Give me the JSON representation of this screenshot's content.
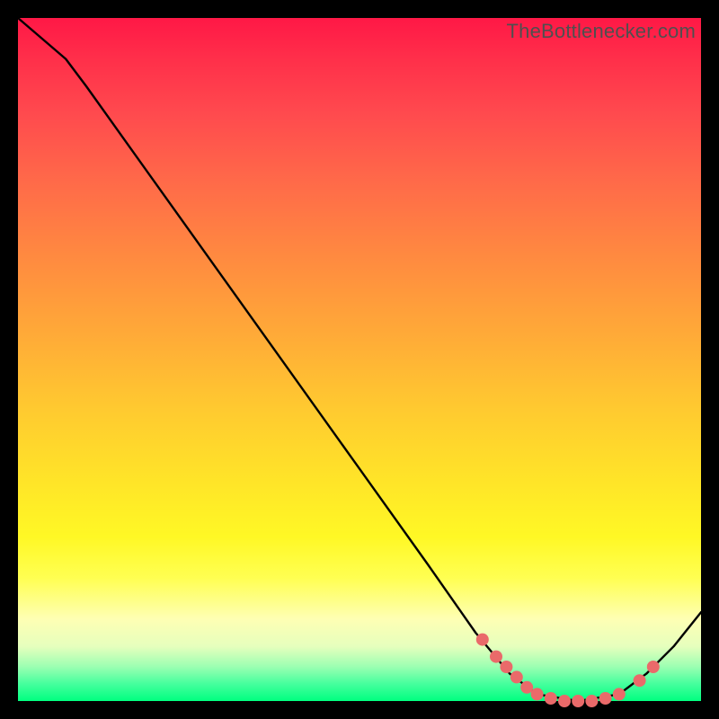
{
  "watermark": "TheBottlenecker.com",
  "colors": {
    "marker": "#ea6a6a",
    "curve": "#000000",
    "frame_bg": "#000000"
  },
  "chart_data": {
    "type": "line",
    "title": "",
    "xlabel": "",
    "ylabel": "",
    "xlim": [
      0,
      100
    ],
    "ylim": [
      0,
      100
    ],
    "curve_points": [
      {
        "x": 0,
        "y_pct": 0
      },
      {
        "x": 7,
        "y_pct": 6
      },
      {
        "x": 10,
        "y_pct": 10
      },
      {
        "x": 20,
        "y_pct": 24
      },
      {
        "x": 30,
        "y_pct": 38
      },
      {
        "x": 40,
        "y_pct": 52
      },
      {
        "x": 50,
        "y_pct": 66
      },
      {
        "x": 60,
        "y_pct": 80
      },
      {
        "x": 67,
        "y_pct": 90
      },
      {
        "x": 72,
        "y_pct": 96
      },
      {
        "x": 76,
        "y_pct": 99
      },
      {
        "x": 82,
        "y_pct": 100
      },
      {
        "x": 88,
        "y_pct": 99
      },
      {
        "x": 92,
        "y_pct": 96
      },
      {
        "x": 96,
        "y_pct": 92
      },
      {
        "x": 100,
        "y_pct": 87
      }
    ],
    "markers": [
      {
        "x": 68,
        "y_pct": 91
      },
      {
        "x": 70,
        "y_pct": 93.5
      },
      {
        "x": 71.5,
        "y_pct": 95
      },
      {
        "x": 73,
        "y_pct": 96.5
      },
      {
        "x": 74.5,
        "y_pct": 98
      },
      {
        "x": 76,
        "y_pct": 99
      },
      {
        "x": 78,
        "y_pct": 99.6
      },
      {
        "x": 80,
        "y_pct": 100
      },
      {
        "x": 82,
        "y_pct": 100
      },
      {
        "x": 84,
        "y_pct": 100
      },
      {
        "x": 86,
        "y_pct": 99.6
      },
      {
        "x": 88,
        "y_pct": 99
      },
      {
        "x": 91,
        "y_pct": 97
      },
      {
        "x": 93,
        "y_pct": 95
      }
    ]
  }
}
